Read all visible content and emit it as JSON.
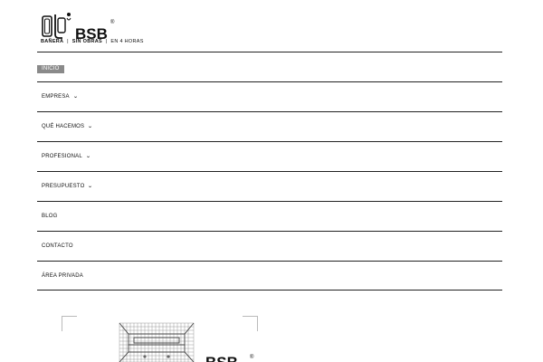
{
  "brand": {
    "name": "BSB",
    "registered": "®",
    "tagline_part1": "BAÑERA",
    "tagline_part2": "SIN OBRAS",
    "tagline_part3": "EN 4 HORAS",
    "separator": "|"
  },
  "nav": {
    "items": [
      {
        "label": "INICIO",
        "has_dropdown": false,
        "active": true
      },
      {
        "label": "EMPRESA",
        "has_dropdown": true
      },
      {
        "label": "QUÉ HACEMOS",
        "has_dropdown": true
      },
      {
        "label": "PROFESIONAL",
        "has_dropdown": true
      },
      {
        "label": "PRESUPUESTO",
        "has_dropdown": true
      },
      {
        "label": "BLOG",
        "has_dropdown": false
      },
      {
        "label": "CONTACTO",
        "has_dropdown": false
      },
      {
        "label": "ÁREA PRIVADA",
        "has_dropdown": false
      }
    ],
    "chevron": "⌄"
  },
  "colors": {
    "active_bg": "#8a8a8a",
    "divider": "#222222"
  },
  "icons": {
    "logo": "bathtub-logo-icon",
    "dropdown": "chevron-down-icon",
    "illustration": "shower-tray-illustration"
  }
}
